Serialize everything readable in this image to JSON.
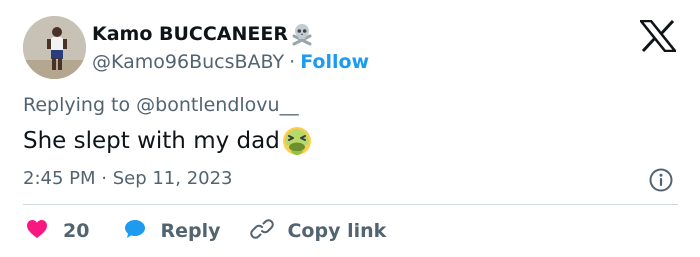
{
  "author": {
    "display_name": "Kamo BUCCANEER",
    "badge_icon": "skull-crossbones-icon",
    "handle": "@Kamo96BucsBABY",
    "separator": "·",
    "follow_label": "Follow",
    "avatar": "avatar-photo"
  },
  "reply_context": "Replying to @bontlendlovu__",
  "tweet": {
    "text": "She slept with my dad",
    "emoji_icon": "nauseated-face-icon"
  },
  "timestamp": "2:45 PM · Sep 11, 2023",
  "actions": {
    "like_count": "20",
    "reply_label": "Reply",
    "copy_label": "Copy link"
  },
  "colors": {
    "accent": "#1d9bf0",
    "like": "#f91880",
    "muted": "#536471",
    "text": "#0f1419",
    "divider": "#cfd9de"
  }
}
